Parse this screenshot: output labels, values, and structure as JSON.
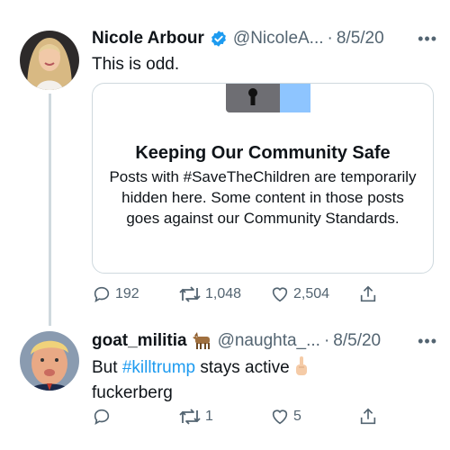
{
  "tweets": [
    {
      "name": "Nicole Arbour",
      "handle": "@NicoleA...",
      "separator": "·",
      "date": "8/5/20",
      "more": "•••",
      "text": "This is odd.",
      "card": {
        "title": "Keeping Our Community Safe",
        "body": "Posts with #SaveTheChildren are temporarily hidden here. Some content in those posts goes against our Community Standards."
      },
      "actions": {
        "replies": "192",
        "retweets": "1,048",
        "likes": "2,504"
      }
    },
    {
      "name": "goat_militia",
      "handle": "@naughta_...",
      "separator": "·",
      "date": "8/5/20",
      "more": "•••",
      "text_before": "But ",
      "hashtag": "#killtrump",
      "text_after": " stays active ",
      "text_line2": "fuckerberg",
      "actions": {
        "replies": "",
        "retweets": "1",
        "likes": "5"
      }
    }
  ],
  "icons": {
    "verified": "verified-badge-icon",
    "goat": "goat-emoji-icon",
    "finger": "middle-finger-emoji-icon",
    "lock": "keyhole-icon",
    "reply": "reply-icon",
    "retweet": "retweet-icon",
    "like": "heart-icon",
    "share": "share-icon"
  },
  "colors": {
    "accent": "#1d9bf0",
    "secondary_text": "#536471",
    "border": "#cfd9de"
  }
}
